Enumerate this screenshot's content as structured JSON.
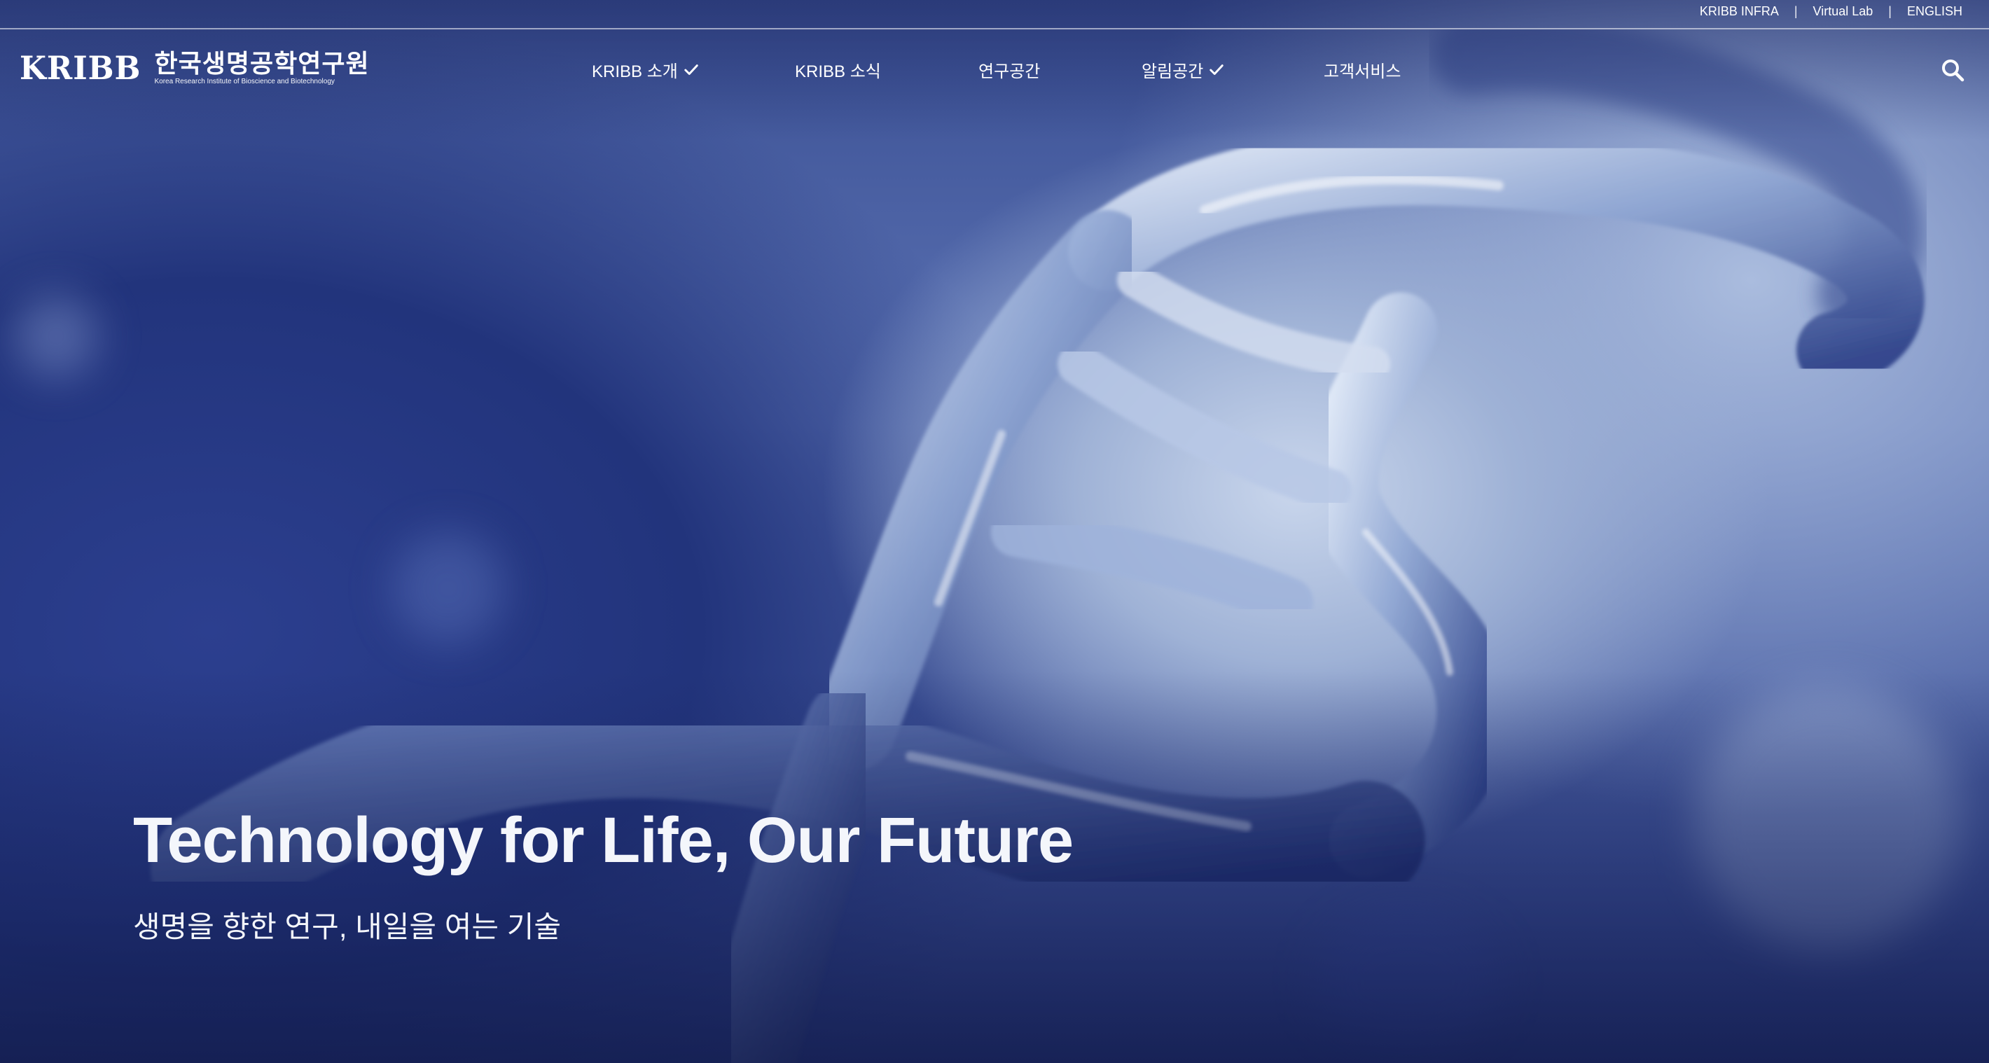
{
  "utility": {
    "links": [
      "KRIBB INFRA",
      "Virtual Lab",
      "ENGLISH"
    ],
    "separator": "|"
  },
  "logo": {
    "mark": "KRIBB",
    "name_kr": "한국생명공학연구원",
    "name_en": "Korea Research Institute of Bioscience and Biotechnology"
  },
  "nav": {
    "items": [
      {
        "label": "KRIBB 소개",
        "icon": "check-icon"
      },
      {
        "label": "KRIBB 소식"
      },
      {
        "label": "연구공간"
      },
      {
        "label": "알림공간",
        "icon": "check-icon"
      },
      {
        "label": "고객서비스"
      }
    ],
    "search_icon": "search-icon"
  },
  "hero": {
    "title": "Technology for Life, Our Future",
    "subtitle": "생명을 향한 연구, 내일을 여는 기술"
  },
  "colors": {
    "text": "#ffffff",
    "background_deep": "#22347c",
    "background_light": "#c9d6ec"
  }
}
